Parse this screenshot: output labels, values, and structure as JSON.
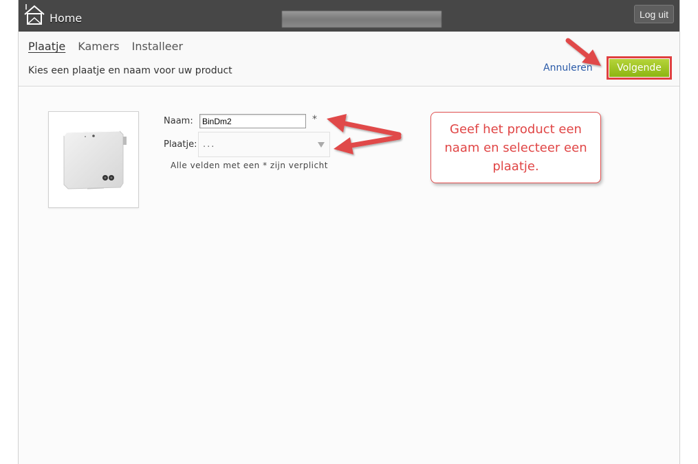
{
  "header": {
    "home_label": "Home",
    "logout_label": "Log uit"
  },
  "tabs": [
    {
      "label": "Plaatje",
      "active": true
    },
    {
      "label": "Kamers",
      "active": false
    },
    {
      "label": "Installeer",
      "active": false
    }
  ],
  "instruction": "Kies een plaatje en naam voor uw product",
  "actions": {
    "cancel_label": "Annuleren",
    "next_label": "Volgende"
  },
  "form": {
    "name_label": "Naam:",
    "name_value": "BinDm2",
    "required_marker": "*",
    "image_label": "Plaatje:",
    "image_selected": "...",
    "required_note": "Alle velden met een * zijn verplicht"
  },
  "callout": {
    "lines": [
      "Geef het product een",
      "naam en selecteer een",
      "plaatje."
    ]
  },
  "colors": {
    "top_bar": "#474747",
    "next_button": "#9dc41e",
    "highlight_red": "#e04040",
    "link_blue": "#2a5aa8"
  }
}
